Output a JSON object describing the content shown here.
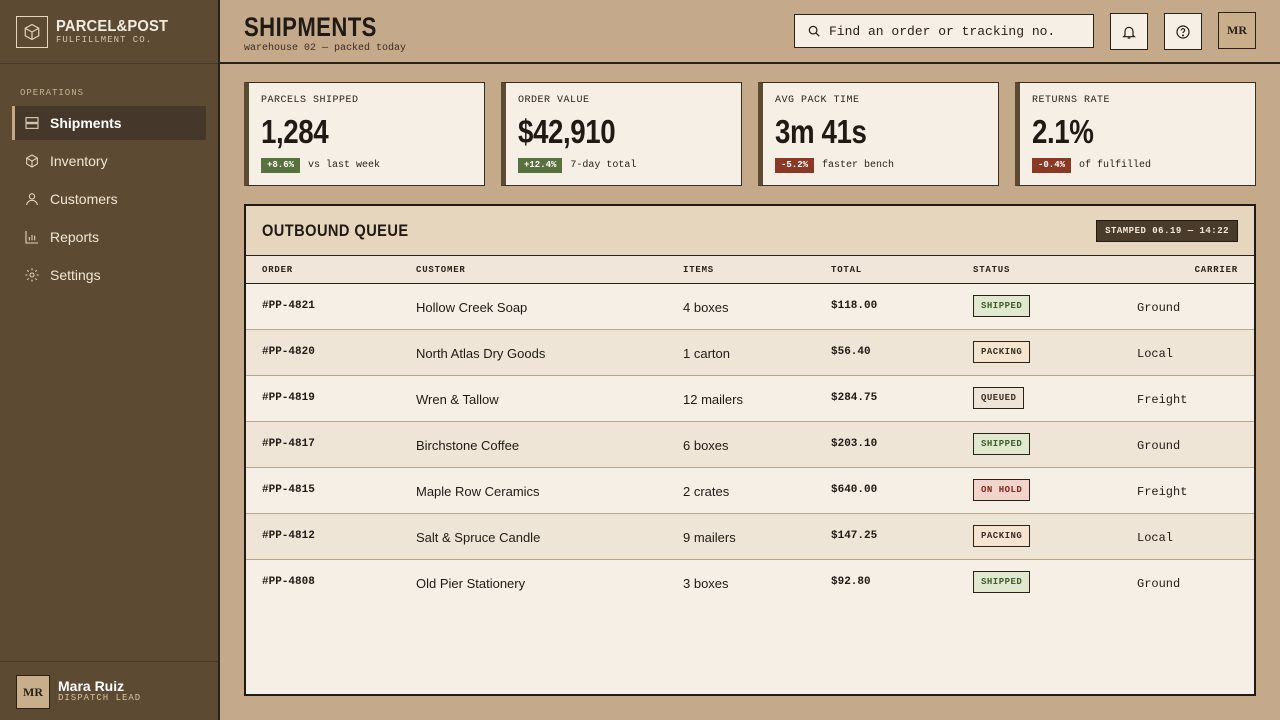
{
  "brand": {
    "name": "PARCEL&POST",
    "sub": "FULFILLMENT CO."
  },
  "sidebar": {
    "section": "OPERATIONS",
    "items": [
      {
        "label": "Shipments",
        "icon": "rows-icon"
      },
      {
        "label": "Inventory",
        "icon": "box-icon"
      },
      {
        "label": "Customers",
        "icon": "user-icon"
      },
      {
        "label": "Reports",
        "icon": "bar-chart-icon"
      },
      {
        "label": "Settings",
        "icon": "gear-icon"
      }
    ],
    "user": {
      "initials": "MR",
      "name": "Mara Ruiz",
      "role": "DISPATCH LEAD"
    }
  },
  "header": {
    "title": "SHIPMENTS",
    "subtitle": "warehouse 02 — packed today",
    "search_placeholder": "Find an order or tracking no.",
    "avatar": "MR"
  },
  "stats": [
    {
      "label": "PARCELS SHIPPED",
      "value": "1,284",
      "delta": "+8.6%",
      "trend": "up",
      "note": "vs last week"
    },
    {
      "label": "ORDER VALUE",
      "value": "$42,910",
      "delta": "+12.4%",
      "trend": "up",
      "note": "7-day total"
    },
    {
      "label": "AVG PACK TIME",
      "value": "3m 41s",
      "delta": "-5.2%",
      "trend": "down",
      "note": "faster bench"
    },
    {
      "label": "RETURNS RATE",
      "value": "2.1%",
      "delta": "-0.4%",
      "trend": "down",
      "note": "of fulfilled"
    }
  ],
  "queue": {
    "title": "OUTBOUND QUEUE",
    "stamp": "STAMPED 06.19 — 14:22",
    "columns": [
      "ORDER",
      "CUSTOMER",
      "ITEMS",
      "TOTAL",
      "STATUS",
      "CARRIER"
    ],
    "rows": [
      {
        "order": "#PP-4821",
        "customer": "Hollow Creek Soap",
        "items": "4 boxes",
        "total": "$118.00",
        "status": "SHIPPED",
        "carrier": "Ground"
      },
      {
        "order": "#PP-4820",
        "customer": "North Atlas Dry Goods",
        "items": "1 carton",
        "total": "$56.40",
        "status": "PACKING",
        "carrier": "Local"
      },
      {
        "order": "#PP-4819",
        "customer": "Wren & Tallow",
        "items": "12 mailers",
        "total": "$284.75",
        "status": "QUEUED",
        "carrier": "Freight"
      },
      {
        "order": "#PP-4817",
        "customer": "Birchstone Coffee",
        "items": "6 boxes",
        "total": "$203.10",
        "status": "SHIPPED",
        "carrier": "Ground"
      },
      {
        "order": "#PP-4815",
        "customer": "Maple Row Ceramics",
        "items": "2 crates",
        "total": "$640.00",
        "status": "ON HOLD",
        "carrier": "Freight"
      },
      {
        "order": "#PP-4812",
        "customer": "Salt & Spruce Candle",
        "items": "9 mailers",
        "total": "$147.25",
        "status": "PACKING",
        "carrier": "Local"
      },
      {
        "order": "#PP-4808",
        "customer": "Old Pier Stationery",
        "items": "3 boxes",
        "total": "$92.80",
        "status": "SHIPPED",
        "carrier": "Ground"
      }
    ]
  },
  "colors": {
    "sidebar": "#5c4a33",
    "page": "#c4a98a",
    "card": "#f5efe6",
    "up": "#57723e",
    "down": "#8a3a24"
  }
}
